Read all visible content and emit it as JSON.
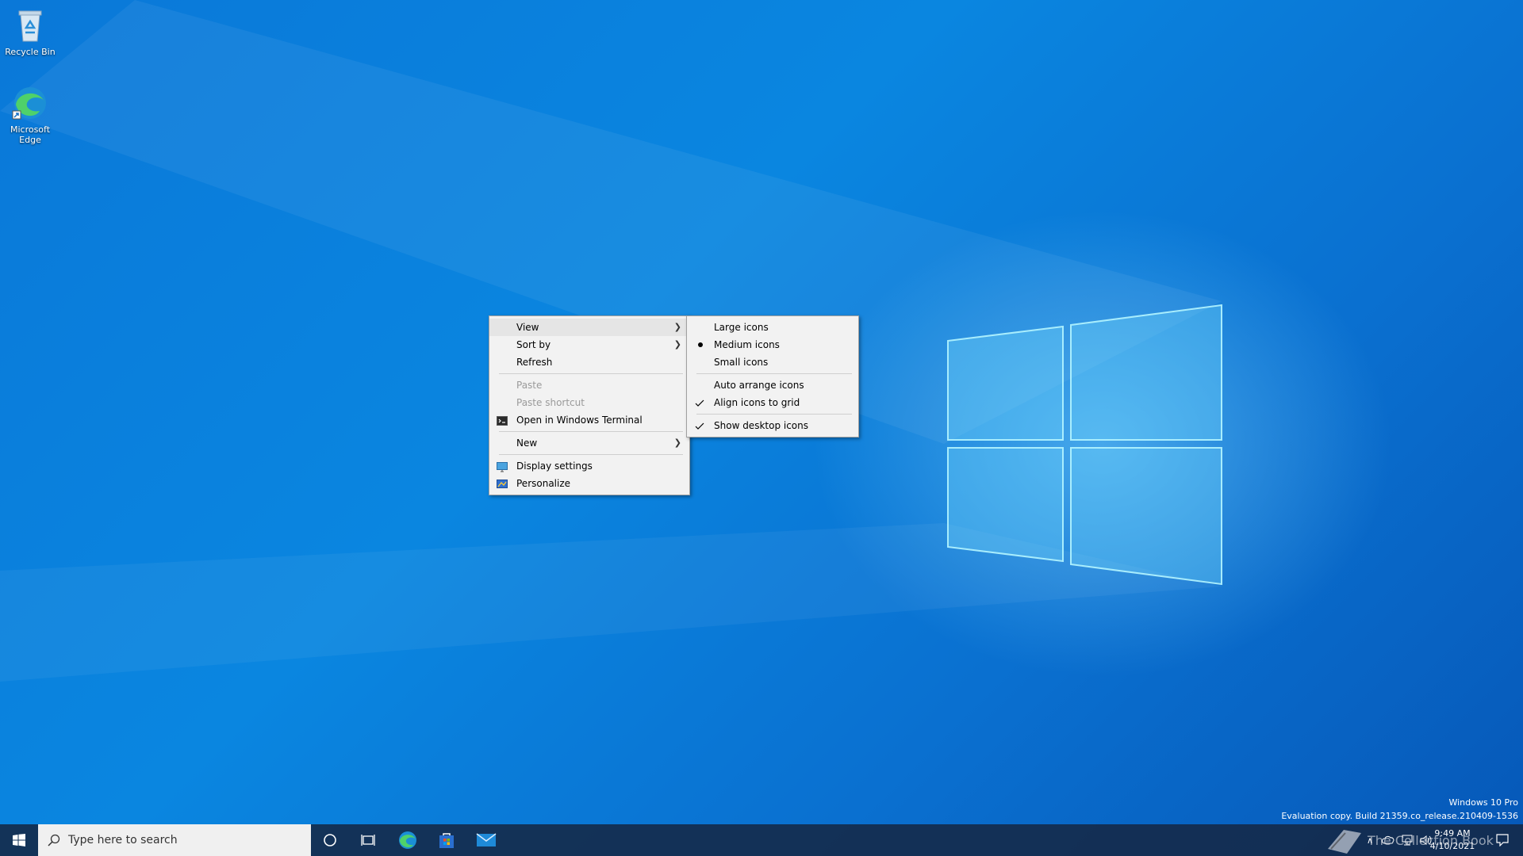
{
  "desktop": {
    "icons": [
      {
        "label": "Recycle Bin"
      },
      {
        "label": "Microsoft Edge"
      }
    ]
  },
  "context_menu": {
    "items": [
      {
        "label": "View",
        "has_submenu": true,
        "highlighted": true
      },
      {
        "label": "Sort by",
        "has_submenu": true
      },
      {
        "label": "Refresh"
      },
      {
        "label": "Paste",
        "disabled": true
      },
      {
        "label": "Paste shortcut",
        "disabled": true
      },
      {
        "label": "Open in Windows Terminal",
        "icon": "terminal-icon"
      },
      {
        "label": "New",
        "has_submenu": true
      },
      {
        "label": "Display settings",
        "icon": "display-icon"
      },
      {
        "label": "Personalize",
        "icon": "personalize-icon"
      }
    ]
  },
  "view_submenu": {
    "items": [
      {
        "label": "Large icons"
      },
      {
        "label": "Medium icons",
        "mark": "bullet"
      },
      {
        "label": "Small icons"
      },
      {
        "label": "Auto arrange icons"
      },
      {
        "label": "Align icons to grid",
        "mark": "check"
      },
      {
        "label": "Show desktop icons",
        "mark": "check"
      }
    ]
  },
  "watermark": {
    "line1": "Windows 10 Pro",
    "line2": "Evaluation copy. Build 21359.co_release.210409-1536"
  },
  "taskbar": {
    "search_placeholder": "Type here to search",
    "pinned": [
      "cortana-icon",
      "task-view-icon",
      "edge-icon",
      "store-icon",
      "mail-icon"
    ],
    "clock_time": "9:49 AM",
    "clock_date": "4/10/2021"
  },
  "overlay_logo_text": "The Collection Book",
  "colors": {
    "accent": "#0078d7",
    "menu_bg": "#f2f2f2"
  }
}
